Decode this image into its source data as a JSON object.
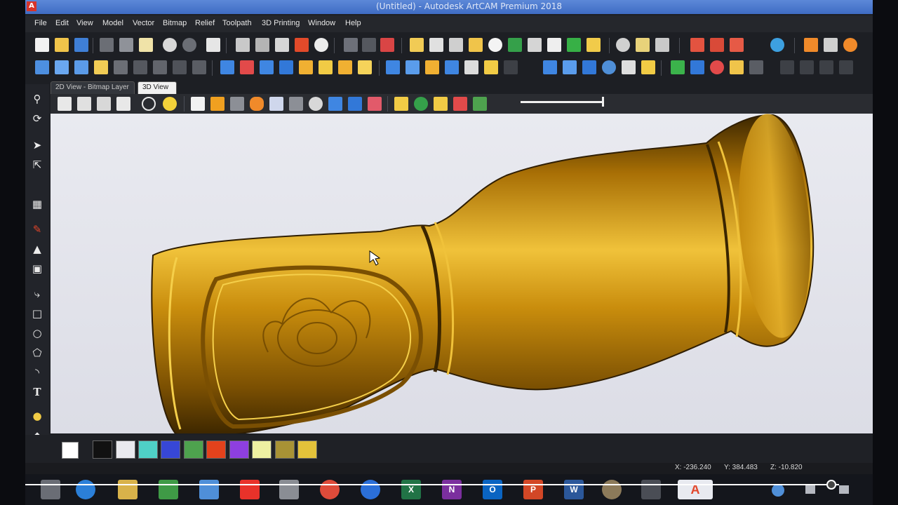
{
  "window": {
    "title": "(Untitled) - Autodesk ArtCAM Premium 2018",
    "logo_letter": "A"
  },
  "menu": [
    "File",
    "Edit",
    "View",
    "Model",
    "Vector",
    "Bitmap",
    "Relief",
    "Toolpath",
    "3D Printing",
    "Window",
    "Help"
  ],
  "tabs": [
    {
      "label": "2D View - Bitmap Layer",
      "active": false
    },
    {
      "label": "3D View",
      "active": true
    }
  ],
  "status": {
    "x": "X: -236.240",
    "y": "Y: 384.483",
    "z": "Z: -10.820"
  },
  "palette": [
    "#111111",
    "#e9e9ee",
    "#4fd0c6",
    "#3747d6",
    "#4ea24e",
    "#e3421c",
    "#8e3fe0",
    "#eef0a2",
    "#a89235",
    "#e3c23a"
  ],
  "taskbar_apps": [
    "windows-start-icon",
    "internet-explorer-icon",
    "file-explorer-icon",
    "store-icon",
    "dropbox-icon",
    "media-icon",
    "cloud-icon",
    "chrome-icon",
    "ccleaner-icon",
    "excel-icon",
    "onenote-icon",
    "outlook-icon",
    "powerpoint-icon",
    "word-icon",
    "gimp-icon",
    "app-icon",
    "artcam-icon"
  ],
  "taskbar_letters": {
    "excel": "X",
    "onenote": "N",
    "outlook": "O",
    "powerpoint": "P",
    "word": "W",
    "artcam": "A"
  },
  "left_tool_text": "T",
  "colors": {
    "accent": "#3f6cc4",
    "model_gold": "#d49a12",
    "viewport_bg": "#e3e4ec"
  }
}
